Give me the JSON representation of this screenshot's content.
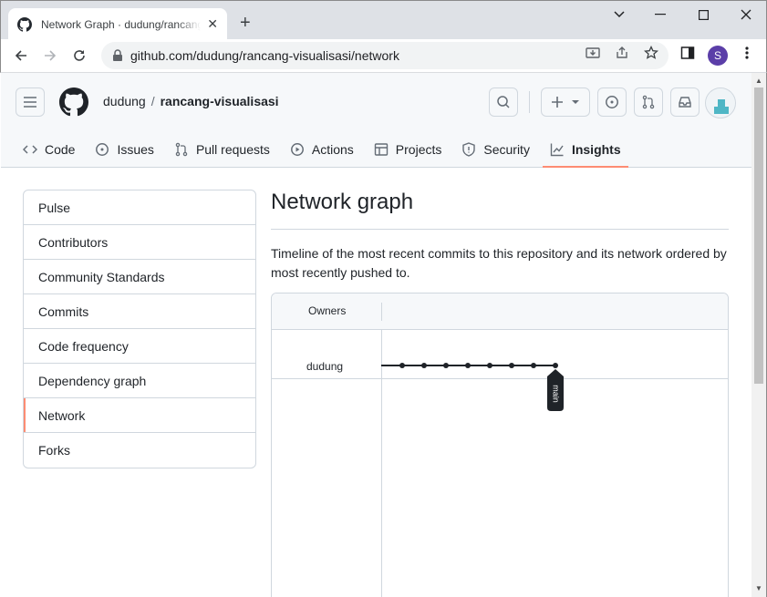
{
  "browser": {
    "tab_title": "Network Graph · dudung/rancang-visualisasi",
    "url": "github.com/dudung/rancang-visualisasi/network",
    "profile_initial": "S"
  },
  "repo": {
    "owner": "dudung",
    "separator": "/",
    "name": "rancang-visualisasi"
  },
  "nav": [
    {
      "label": "Code",
      "icon": "code-icon"
    },
    {
      "label": "Issues",
      "icon": "issue-icon"
    },
    {
      "label": "Pull requests",
      "icon": "pull-request-icon"
    },
    {
      "label": "Actions",
      "icon": "play-icon"
    },
    {
      "label": "Projects",
      "icon": "table-icon"
    },
    {
      "label": "Security",
      "icon": "shield-icon"
    },
    {
      "label": "Insights",
      "icon": "graph-icon",
      "active": true
    }
  ],
  "sidebar": {
    "items": [
      {
        "label": "Pulse"
      },
      {
        "label": "Contributors"
      },
      {
        "label": "Community Standards"
      },
      {
        "label": "Commits"
      },
      {
        "label": "Code frequency"
      },
      {
        "label": "Dependency graph"
      },
      {
        "label": "Network",
        "selected": true
      },
      {
        "label": "Forks"
      }
    ]
  },
  "main": {
    "title": "Network graph",
    "description": "Timeline of the most recent commits to this repository and its network ordered by most recently pushed to."
  },
  "network": {
    "owners_label": "Owners",
    "user": "dudung",
    "branch_label": "main",
    "commit_count": 8
  },
  "colors": {
    "accent": "#fd8c73",
    "border": "#d0d7de",
    "profile": "#5b3ea8"
  }
}
